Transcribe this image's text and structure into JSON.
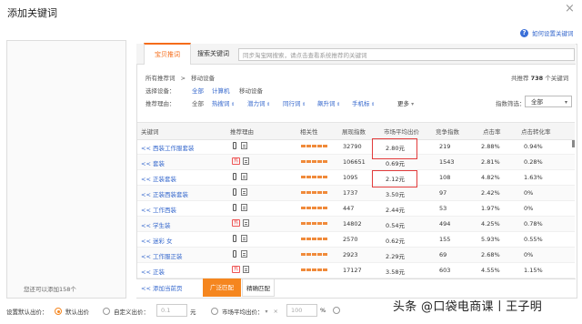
{
  "dialog": {
    "title": "添加关键词",
    "close": "×"
  },
  "help": {
    "icon": "question-circle-icon",
    "text": "如何设置关键词"
  },
  "left_panel": {
    "note": "您还可以添加158个"
  },
  "tabs": [
    {
      "label": "宝贝推词"
    },
    {
      "label": "搜索关键词"
    }
  ],
  "search": {
    "placeholder": "同步淘宝网搜索，请点击查看系统推荐的关键词"
  },
  "crumb": {
    "root": "所有推荐词",
    "sep": ">",
    "current": "移动设备"
  },
  "total": {
    "prefix": "共推荐",
    "count": "738",
    "suffix": "个关键词"
  },
  "device": {
    "label": "选择设备：",
    "options": [
      "全部",
      "计算机",
      "移动设备"
    ]
  },
  "reason": {
    "label": "推荐理由：",
    "options": [
      "全部",
      "热搜词",
      "潜力词",
      "同行词",
      "飙升词",
      "手机标"
    ],
    "more": "更多"
  },
  "index_filter": {
    "label": "指数筛选：",
    "value": "全部"
  },
  "columns": [
    "关键词",
    "推荐理由",
    "相关性",
    "展现指数",
    "市场平均出价",
    "竞争指数",
    "点击率",
    "点击转化率"
  ],
  "rows": [
    {
      "kw": "<< 西装工作服套装",
      "hot": false,
      "impr": "32790",
      "bid": "2.80元",
      "comp": "219",
      "ctr": "2.88%",
      "cvr": "0.94%"
    },
    {
      "kw": "<< 套装",
      "hot": true,
      "impr": "106651",
      "bid": "0.69元",
      "comp": "1543",
      "ctr": "2.81%",
      "cvr": "0.28%"
    },
    {
      "kw": "<< 正装套装",
      "hot": false,
      "impr": "1095",
      "bid": "2.12元",
      "comp": "108",
      "ctr": "4.82%",
      "cvr": "1.63%"
    },
    {
      "kw": "<< 正装西装套装",
      "hot": false,
      "impr": "1737",
      "bid": "3.50元",
      "comp": "97",
      "ctr": "2.42%",
      "cvr": "0%"
    },
    {
      "kw": "<< 工作西装",
      "hot": false,
      "impr": "447",
      "bid": "2.44元",
      "comp": "53",
      "ctr": "1.97%",
      "cvr": "0%"
    },
    {
      "kw": "<< 学生装",
      "hot": true,
      "impr": "14802",
      "bid": "0.54元",
      "comp": "494",
      "ctr": "4.25%",
      "cvr": "0.78%"
    },
    {
      "kw": "<< 迷彩 女",
      "hot": false,
      "impr": "2570",
      "bid": "0.62元",
      "comp": "155",
      "ctr": "5.93%",
      "cvr": "0.55%"
    },
    {
      "kw": "<< 工作服正装",
      "hot": false,
      "impr": "2923",
      "bid": "2.29元",
      "comp": "69",
      "ctr": "2.68%",
      "cvr": "0%"
    },
    {
      "kw": "<< 正装",
      "hot": true,
      "impr": "17127",
      "bid": "3.58元",
      "comp": "603",
      "ctr": "4.55%",
      "cvr": "1.15%"
    }
  ],
  "hot_badge": "热",
  "bottom": {
    "add_all": "<< 添加当前页",
    "match": "广泛匹配",
    "exact": "精确匹配"
  },
  "bid": {
    "label": "设置默认出价：",
    "default": "默认出价",
    "custom": "自定义出价：",
    "custom_value": "0.1",
    "unit": "元",
    "market": "市场平均出价：",
    "pct_value": "100",
    "pct": "%"
  },
  "watermark": "头条 @口袋电商课丨王子明",
  "colors": {
    "accent": "#f5861f",
    "link": "#3366cc",
    "highlight": "#e23b3b"
  }
}
